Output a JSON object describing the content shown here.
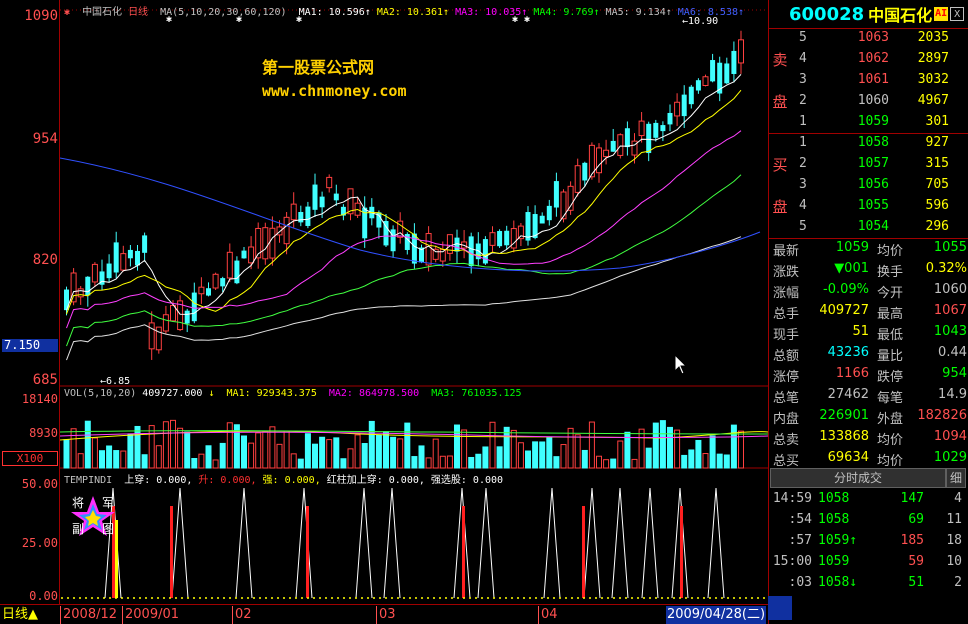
{
  "chart": {
    "name": "中国石化",
    "period": "日线",
    "ma_params": "MA(5,10,20,30,60,120)",
    "ma_values": [
      {
        "label": "MA1: 10.596",
        "color": "#ffffff"
      },
      {
        "label": "MA2: 10.361",
        "color": "#ffff00"
      },
      {
        "label": "MA3: 10.035",
        "color": "#ff00ff"
      },
      {
        "label": "MA4: 9.769",
        "color": "#00ff00"
      },
      {
        "label": "MA5: 9.134",
        "color": "#c0c0c0"
      },
      {
        "label": "MA6: 8.538",
        "color": "#4060ff"
      }
    ],
    "y_labels": [
      "1090",
      "954",
      "820",
      "685"
    ],
    "current_price_marker": "7.150",
    "high_annotation": "10.90",
    "low_annotation": "6.85",
    "watermark_line1": "第一股票公式网",
    "watermark_line2": "www.chnmoney.com"
  },
  "volume": {
    "legend_main": "VOL(5,10,20)",
    "legend_value": "409727.000",
    "legend_ma1": "MA1: 929343.375",
    "legend_ma2": "MA2: 864978.500",
    "legend_ma3": "MA3: 761035.125",
    "y_labels": [
      "18140",
      "8930"
    ],
    "unit": "X100"
  },
  "indicator": {
    "name": "TEMPINDI",
    "items": [
      {
        "label": "上穿: 0.000,",
        "color": "#ffffff"
      },
      {
        "label": "升: 0.000,",
        "color": "#ff3030"
      },
      {
        "label": "强: 0.000,",
        "color": "#ffff00"
      },
      {
        "label": "红柱加上穿: 0.000,",
        "color": "#ffffff"
      },
      {
        "label": "强选股: 0.000",
        "color": "#ffffff"
      }
    ],
    "y_labels": [
      "50.00",
      "25.00",
      "0.00"
    ],
    "logo_chars": [
      "将",
      "军",
      "副",
      "图"
    ]
  },
  "bottom": {
    "period_tab": "日线",
    "dates": [
      "2008/12",
      "2009/01",
      "02",
      "03",
      "04"
    ],
    "current_date": "2009/04/28(二)"
  },
  "quote": {
    "code": "600028",
    "name": "中国石化",
    "badge": "AI",
    "close_btn": "X",
    "sell_label": [
      "卖",
      "盘"
    ],
    "buy_label": [
      "买",
      "盘"
    ],
    "sell": [
      {
        "idx": "5",
        "price": "1063",
        "vol": "2035",
        "color": "#ff5050"
      },
      {
        "idx": "4",
        "price": "1062",
        "vol": "2897",
        "color": "#ff5050"
      },
      {
        "idx": "3",
        "price": "1061",
        "vol": "3032",
        "color": "#ff5050"
      },
      {
        "idx": "2",
        "price": "1060",
        "vol": "4967",
        "color": "#c0c0c0"
      },
      {
        "idx": "1",
        "price": "1059",
        "vol": "301",
        "color": "#00ff00"
      }
    ],
    "buy": [
      {
        "idx": "1",
        "price": "1058",
        "vol": "927",
        "color": "#00ff00"
      },
      {
        "idx": "2",
        "price": "1057",
        "vol": "315",
        "color": "#00ff00"
      },
      {
        "idx": "3",
        "price": "1056",
        "vol": "705",
        "color": "#00ff00"
      },
      {
        "idx": "4",
        "price": "1055",
        "vol": "596",
        "color": "#00ff00"
      },
      {
        "idx": "5",
        "price": "1054",
        "vol": "296",
        "color": "#00ff00"
      }
    ],
    "stats": [
      {
        "l1": "最新",
        "v1": "1059",
        "c1": "#00ff00",
        "l2": "均价",
        "v2": "1055",
        "c2": "#00ff00"
      },
      {
        "l1": "涨跌",
        "v1": "▼001",
        "c1": "#00ff00",
        "l2": "换手",
        "v2": "0.32%",
        "c2": "#ffff00"
      },
      {
        "l1": "涨幅",
        "v1": "-0.09%",
        "c1": "#00ff00",
        "l2": "今开",
        "v2": "1060",
        "c2": "#c0c0c0"
      },
      {
        "l1": "总手",
        "v1": "409727",
        "c1": "#ffff00",
        "l2": "最高",
        "v2": "1067",
        "c2": "#ff5050"
      },
      {
        "l1": "现手",
        "v1": "51",
        "c1": "#ffff00",
        "l2": "最低",
        "v2": "1043",
        "c2": "#00ff00"
      },
      {
        "l1": "总额",
        "v1": "43236",
        "c1": "#00ffff",
        "l2": "量比",
        "v2": "0.44",
        "c2": "#c0c0c0"
      },
      {
        "l1": "涨停",
        "v1": "1166",
        "c1": "#ff5050",
        "l2": "跌停",
        "v2": "954",
        "c2": "#00ff00"
      },
      {
        "l1": "总笔",
        "v1": "27462",
        "c1": "#c0c0c0",
        "l2": "每笔",
        "v2": "14.9",
        "c2": "#c0c0c0"
      },
      {
        "l1": "内盘",
        "v1": "226901",
        "c1": "#00ff00",
        "l2": "外盘",
        "v2": "182826",
        "c2": "#ff5050"
      },
      {
        "l1": "总卖",
        "v1": "133868",
        "c1": "#ffff00",
        "l2": "均价",
        "v2": "1094",
        "c2": "#ff5050"
      },
      {
        "l1": "总买",
        "v1": "69634",
        "c1": "#ffff00",
        "l2": "均价",
        "v2": "1029",
        "c2": "#00ff00"
      }
    ],
    "trades_tab": "分时成交",
    "trades_tab2": "细",
    "trades": [
      {
        "time": "14:59",
        "price": "1058",
        "arrow": "",
        "vol": "147",
        "cnt": "4",
        "vcolor": "#00ff00"
      },
      {
        "time": ":54",
        "price": "1058",
        "arrow": "",
        "vol": "69",
        "cnt": "11",
        "vcolor": "#00ff00"
      },
      {
        "time": ":57",
        "price": "1059",
        "arrow": "↑",
        "vol": "185",
        "cnt": "18",
        "vcolor": "#ff5050"
      },
      {
        "time": "15:00",
        "price": "1059",
        "arrow": "",
        "vol": "59",
        "cnt": "10",
        "vcolor": "#ff5050"
      },
      {
        "time": ":03",
        "price": "1058",
        "arrow": "↓",
        "vol": "51",
        "cnt": "2",
        "vcolor": "#00ff00"
      }
    ]
  }
}
